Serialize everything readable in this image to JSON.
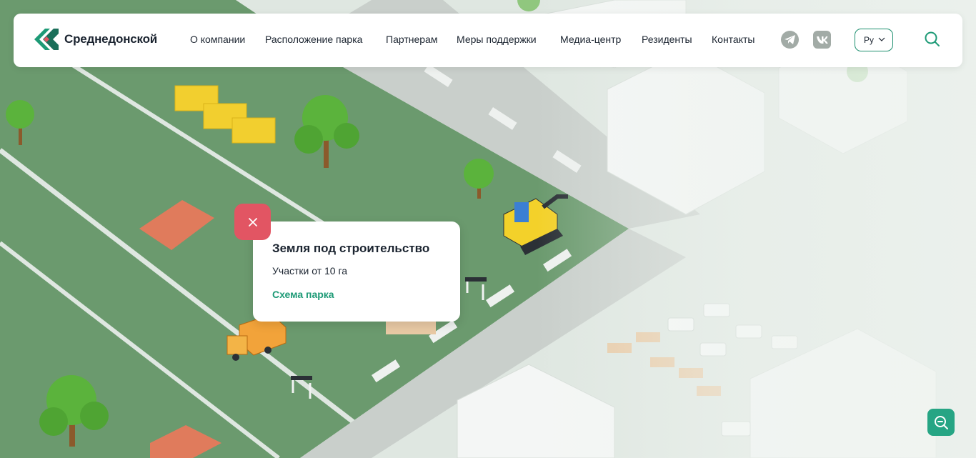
{
  "brand": {
    "name": "Среднедонской",
    "colors": {
      "primary": "#1d9a76",
      "dark": "#1b2430",
      "accent_red": "#e25563",
      "field_green": "#6b9a6e"
    }
  },
  "nav": {
    "items": [
      {
        "label": "О компании"
      },
      {
        "label": "Расположение парка"
      },
      {
        "label": "Партнерам"
      },
      {
        "label": "Меры поддержки"
      },
      {
        "label": "Медиа-центр"
      },
      {
        "label": "Резиденты"
      },
      {
        "label": "Контакты"
      }
    ],
    "social": [
      {
        "icon": "telegram-icon"
      },
      {
        "icon": "vk-icon"
      }
    ],
    "language": "Ру",
    "search_icon": "search-icon"
  },
  "popup": {
    "title": "Земля под строительство",
    "subtitle": "Участки от 10 га",
    "link": "Схема парка",
    "close_icon": "close-icon"
  },
  "map_controls": {
    "zoom_icon": "zoom-out-icon"
  }
}
